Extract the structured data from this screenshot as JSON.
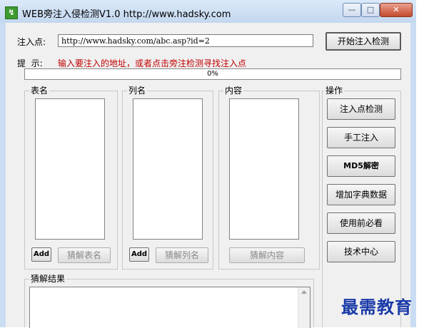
{
  "window": {
    "title": "WEB旁注入侵检测V1.0    http://www.hadsky.com",
    "icon_glyph": "↯",
    "minimize": "—",
    "maximize": "□",
    "close": "✕"
  },
  "form": {
    "inject_label": "注入点:",
    "inject_value": "http://www.hadsky.com/abc.asp?id=2",
    "start_button": "开始注入检测",
    "hint_label": "提  示:",
    "hint_text": "输入要注入的地址，或者点击旁注检测寻找注入点",
    "progress_text": "0%",
    "progress_value": 0
  },
  "groups": {
    "tables": {
      "label": "表名",
      "add": "Add",
      "crack": "猜解表名"
    },
    "columns": {
      "label": "列名",
      "add": "Add",
      "crack": "猜解列名"
    },
    "content": {
      "label": "内容",
      "crack": "猜解内容"
    },
    "ops": {
      "label": "操作",
      "buttons": [
        "注入点检测",
        "手工注入",
        "MD5解密",
        "增加字典数据",
        "使用前必看",
        "技术中心"
      ]
    },
    "results": {
      "label": "猜解结果"
    }
  },
  "watermark": "最需教育",
  "colors": {
    "hint": "#c00000",
    "watermark": "#1a3aa8"
  }
}
